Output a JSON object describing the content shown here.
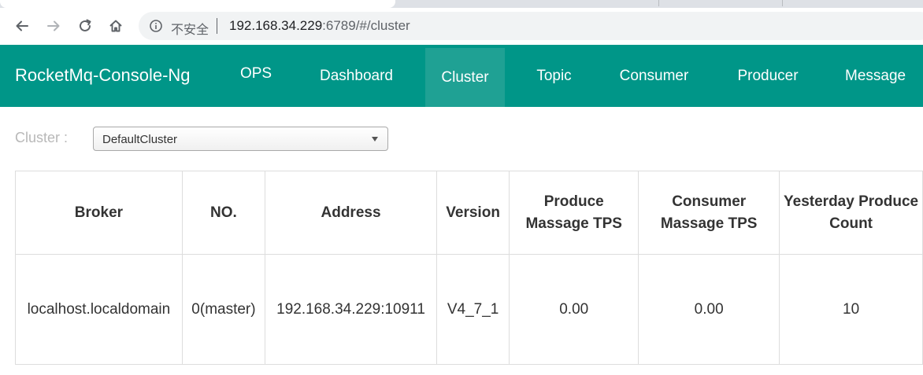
{
  "browser": {
    "security_label": "不安全",
    "url_host": "192.168.34.229",
    "url_rest": ":6789/#/cluster"
  },
  "navbar": {
    "brand": "RocketMq-Console-Ng",
    "items": [
      {
        "label": "OPS",
        "active": false
      },
      {
        "label": "Dashboard",
        "active": false
      },
      {
        "label": "Cluster",
        "active": true
      },
      {
        "label": "Topic",
        "active": false
      },
      {
        "label": "Consumer",
        "active": false
      },
      {
        "label": "Producer",
        "active": false
      },
      {
        "label": "Message",
        "active": false
      }
    ],
    "accent_color": "#009688",
    "active_color": "#1fa194"
  },
  "cluster_filter": {
    "label": "Cluster :",
    "selected": "DefaultCluster"
  },
  "table": {
    "columns": [
      "Broker",
      "NO.",
      "Address",
      "Version",
      "Produce Massage TPS",
      "Consumer Massage TPS",
      "Yesterday Produce Count"
    ],
    "rows": [
      [
        "localhost.localdomain",
        "0(master)",
        "192.168.34.229:10911",
        "V4_7_1",
        "0.00",
        "0.00",
        "10"
      ]
    ]
  }
}
